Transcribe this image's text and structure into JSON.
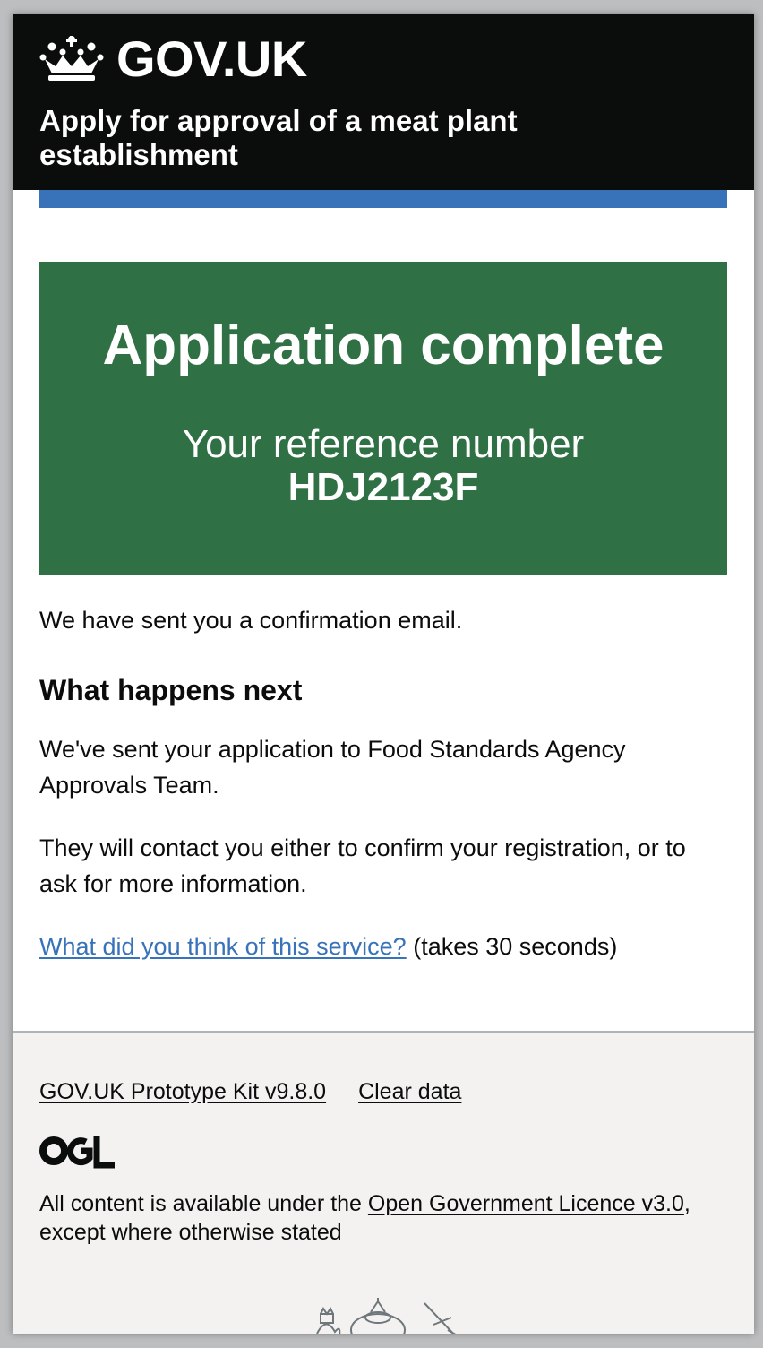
{
  "header": {
    "logo_text": "GOV.UK",
    "service_name": "Apply for approval of a meat plant establishment"
  },
  "panel": {
    "title": "Application complete",
    "reference_label": "Your reference number",
    "reference_number": "HDJ2123F"
  },
  "content": {
    "email_sent": "We have sent you a confirmation email.",
    "next_heading": "What happens next",
    "next_para1": "We've sent your application to Food Standards Agency Approvals Team.",
    "next_para2": "They will contact you either to confirm your registration, or to ask for more information.",
    "feedback_link": "What did you think of this service?",
    "feedback_suffix": " (takes 30 seconds)"
  },
  "footer": {
    "link_prototype": "GOV.UK Prototype Kit v9.8.0",
    "link_clear": "Clear data",
    "ogl_label": "OGL",
    "licence_prefix": "All content is available under the ",
    "licence_link": "Open Government Licence v3.0",
    "licence_suffix": ", except where otherwise stated"
  },
  "colors": {
    "header_bg": "#0b0c0c",
    "accent_blue": "#3872b8",
    "panel_green": "#2f7044",
    "footer_bg": "#f3f2f1",
    "link": "#3872b8"
  },
  "icons": {
    "logo": "crown-icon",
    "licence": "ogl-logo-icon",
    "crest": "royal-coat-of-arms-icon"
  }
}
